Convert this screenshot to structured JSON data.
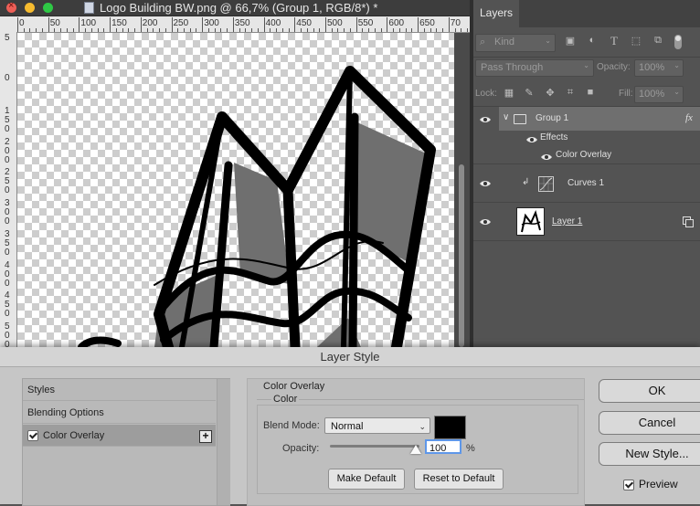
{
  "window": {
    "title": "Logo Building BW.png @ 66,7% (Group 1, RGB/8*) *"
  },
  "ruler": {
    "h_labels": [
      "0",
      "50",
      "100",
      "150",
      "200",
      "250",
      "300",
      "350",
      "400",
      "450",
      "500",
      "550",
      "600",
      "650",
      "70"
    ],
    "v_labels": [
      "5",
      "0",
      "1\n5\n0",
      "2\n0\n0",
      "2\n5\n0",
      "3\n0\n0",
      "3\n5\n0",
      "4\n0\n0",
      "4\n5\n0",
      "5\n0\n0",
      "5\n5\n0",
      "6\n0\n0"
    ]
  },
  "layers": {
    "tab_label": "Layers",
    "filter_kind": "Kind",
    "blend_mode": "Pass Through",
    "opacity_label": "Opacity:",
    "opacity_value": "100%",
    "lock_label": "Lock:",
    "fill_label": "Fill:",
    "fill_value": "100%",
    "rows": {
      "group": "Group 1",
      "fx": "fx",
      "effects": "Effects",
      "overlay": "Color Overlay",
      "curves": "Curves 1",
      "layer1": "Layer 1"
    }
  },
  "dialog": {
    "title": "Layer Style",
    "left_items": {
      "styles": "Styles",
      "blending": "Blending Options",
      "overlay": "Color Overlay",
      "plus": "+"
    },
    "section_title": "Color Overlay",
    "group_title": "Color",
    "blend_label": "Blend Mode:",
    "blend_value": "Normal",
    "overlay_color": "#000000",
    "opacity_label": "Opacity:",
    "opacity_value": "100",
    "opacity_unit": "%",
    "make_default": "Make Default",
    "reset_default": "Reset to Default",
    "ok": "OK",
    "cancel": "Cancel",
    "new_style": "New Style...",
    "preview": "Preview"
  }
}
